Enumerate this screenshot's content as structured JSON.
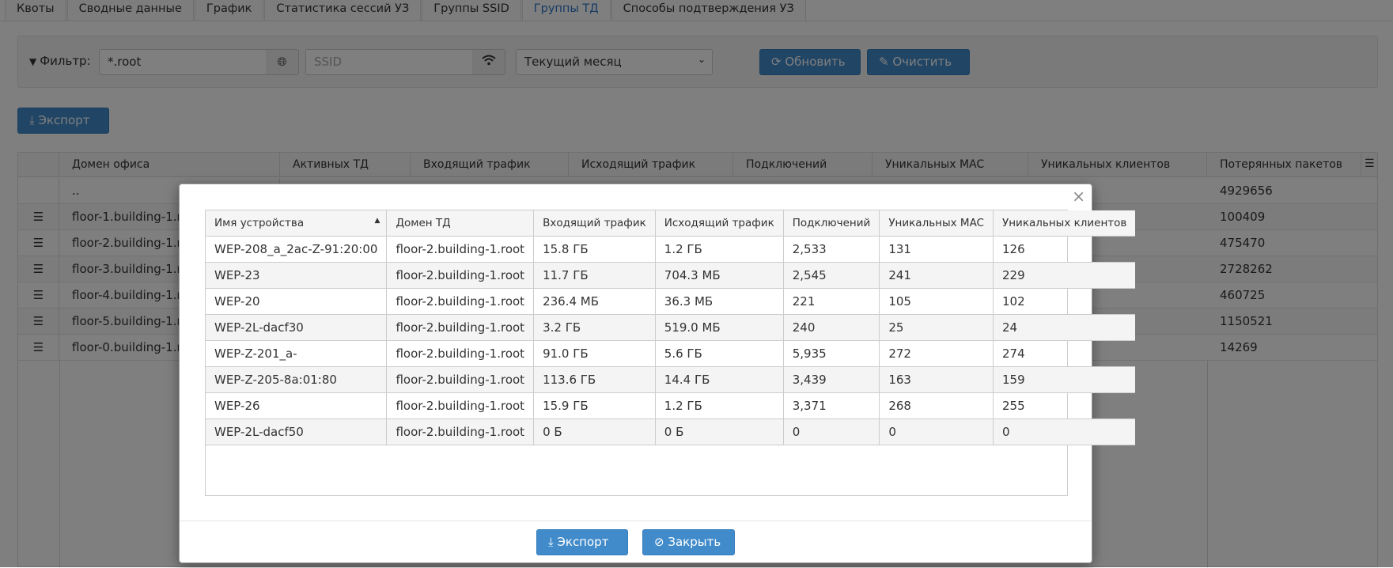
{
  "tabs": [
    "Квоты",
    "Сводные данные",
    "График",
    "Статистика сессий УЗ",
    "Группы SSID",
    "Группы ТД",
    "Способы подтверждения УЗ"
  ],
  "active_tab": "Группы ТД",
  "filter": {
    "label": "Фильтр:",
    "domain_value": "*.root",
    "ssid_placeholder": "SSID",
    "period": "Текущий месяц",
    "refresh_label": "Обновить",
    "clear_label": "Очистить"
  },
  "export_label": "Экспорт",
  "grid": {
    "columns": [
      "Домен офиса",
      "Активных ТД",
      "Входящий трафик",
      "Исходящий трафик",
      "Подключений",
      "Уникальных MAC",
      "Уникальных клиентов",
      "Потерянных пакетов"
    ],
    "rows": [
      {
        "domain": "..",
        "lost": "4929656"
      },
      {
        "domain": "floor-1.building-1.ro",
        "lost": "100409"
      },
      {
        "domain": "floor-2.building-1.ro",
        "lost": "475470"
      },
      {
        "domain": "floor-3.building-1.ro",
        "lost": "2728262"
      },
      {
        "domain": "floor-4.building-1.ro",
        "lost": "460725"
      },
      {
        "domain": "floor-5.building-1.ro",
        "lost": "1150521"
      },
      {
        "domain": "floor-0.building-1.ro",
        "lost": "14269"
      }
    ]
  },
  "modal": {
    "columns": [
      "Имя устройства",
      "Домен ТД",
      "Входящий трафик",
      "Исходящий трафик",
      "Подключений",
      "Уникальных MAC",
      "Уникальных клиентов"
    ],
    "rows": [
      [
        "WEP-208_a_2ac-Z-91:20:00",
        "floor-2.building-1.root",
        "15.8 ГБ",
        "1.2 ГБ",
        "2,533",
        "131",
        "126"
      ],
      [
        "WEP-23",
        "floor-2.building-1.root",
        "11.7 ГБ",
        "704.3 МБ",
        "2,545",
        "241",
        "229"
      ],
      [
        "WEP-20",
        "floor-2.building-1.root",
        "236.4 МБ",
        "36.3 МБ",
        "221",
        "105",
        "102"
      ],
      [
        "WEP-2L-dacf30",
        "floor-2.building-1.root",
        "3.2 ГБ",
        "519.0 МБ",
        "240",
        "25",
        "24"
      ],
      [
        "WEP-Z-201_a-",
        "floor-2.building-1.root",
        "91.0 ГБ",
        "5.6 ГБ",
        "5,935",
        "272",
        "274"
      ],
      [
        "WEP-Z-205-8a:01:80",
        "floor-2.building-1.root",
        "113.6 ГБ",
        "14.4 ГБ",
        "3,439",
        "163",
        "159"
      ],
      [
        "WEP-26",
        "floor-2.building-1.root",
        "15.9 ГБ",
        "1.2 ГБ",
        "3,371",
        "268",
        "255"
      ],
      [
        "WEP-2L-dacf50",
        "floor-2.building-1.root",
        "0 Б",
        "0 Б",
        "0",
        "0",
        "0"
      ]
    ],
    "export_label": "Экспорт",
    "close_label": "Закрыть"
  }
}
